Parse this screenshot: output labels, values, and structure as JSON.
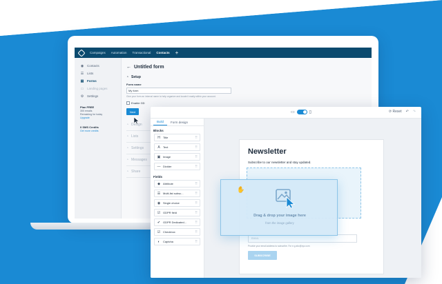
{
  "colors": {
    "accent": "#1a8ad4",
    "nav": "#0b4a6e",
    "background_shape": "#1a8ad4"
  },
  "topnav": {
    "logo_icon": "brand-logo-icon",
    "items": [
      "Campaigns",
      "Automation",
      "Transactional",
      "Contacts"
    ],
    "active_item": "Contacts",
    "add_label": "+"
  },
  "sidebar": {
    "items": [
      {
        "label": "Contacts",
        "icon": "eye-icon"
      },
      {
        "label": "Lists",
        "icon": "list-icon"
      },
      {
        "label": "Forms",
        "icon": "form-icon"
      },
      {
        "label": "Landing pages",
        "icon": "page-icon"
      },
      {
        "label": "Settings",
        "icon": "gear-icon"
      }
    ],
    "plan": {
      "title": "Plan FREE",
      "line1": "300 emails",
      "line2": "Remaining for today",
      "link": "Upgrade"
    },
    "sms": {
      "title": "0 SMS Credits",
      "link": "Get more credits"
    }
  },
  "main": {
    "back_arrow": "←",
    "title": "Untitled form",
    "setup_label": "Setup",
    "form_name_label": "Form name",
    "form_name_value": "My form",
    "form_name_help": "Give your form an internal name to help organize and locate it easily within your account.",
    "enable_label": "Enable GD",
    "next_label": "Next",
    "collapsed_sections": [
      "Design",
      "Lists",
      "Settings",
      "Messages",
      "Share"
    ]
  },
  "editor": {
    "toolbar": {
      "reset_label": "Reset",
      "undo": "↶",
      "redo": "↷"
    },
    "tabs": [
      "Build",
      "Form design"
    ],
    "active_tab": "Build",
    "blocks_label": "Blocks",
    "blocks": [
      {
        "label": "Title",
        "icon": "title-icon",
        "glyph": "H"
      },
      {
        "label": "Text",
        "icon": "text-icon",
        "glyph": "A"
      },
      {
        "label": "Image",
        "icon": "image-icon",
        "glyph": "▣"
      },
      {
        "label": "Divider",
        "icon": "divider-icon",
        "glyph": "—"
      }
    ],
    "fields_label": "Fields",
    "fields": [
      {
        "label": "Attribute",
        "icon": "tag-icon",
        "glyph": "◆"
      },
      {
        "label": "Multi-list subsc...",
        "icon": "multilist-icon",
        "glyph": "☰"
      },
      {
        "label": "Single choice",
        "icon": "radio-icon",
        "glyph": "◉"
      },
      {
        "label": "GDPR field",
        "icon": "gdpr-icon",
        "glyph": "☑"
      },
      {
        "label": "GDPR Dedicated...",
        "icon": "gdpr-dedicated-icon",
        "glyph": "✔"
      },
      {
        "label": "Checkbox",
        "icon": "checkbox-icon",
        "glyph": "☑"
      },
      {
        "label": "Captcha",
        "icon": "captcha-icon",
        "glyph": "◐"
      }
    ],
    "grip_glyph": "⠿",
    "canvas": {
      "title": "Newsletter",
      "subtitle": "Subscribe to our newsletter and stay updated.",
      "email_placeholder": "EMAIL",
      "email_help": "Provide your email address to subscribe. For e.g abc@xyz.com",
      "subscribe_label": "SUBSCRIBE"
    },
    "drag": {
      "title": "Drag & drop your image here",
      "subtitle": "from the image gallery"
    }
  }
}
